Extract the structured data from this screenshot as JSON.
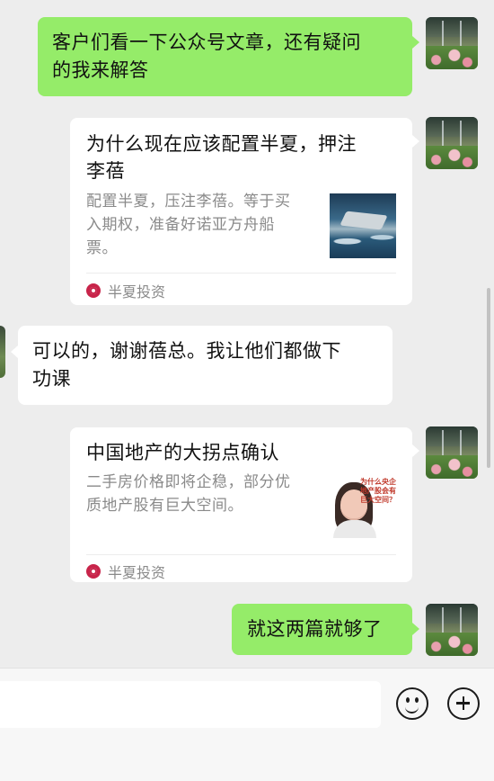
{
  "messages": [
    {
      "side": "right",
      "type": "text",
      "lines": [
        "客户们看一下公众号文章，还有疑问",
        "的我来解答"
      ]
    },
    {
      "side": "right",
      "type": "article",
      "title_lines": [
        "为什么现在应该配置半夏，押注",
        "李蓓"
      ],
      "desc_lines": [
        "配置半夏，压注李蓓。等于买",
        "入期权，准备好诺亚方舟船",
        "票。"
      ],
      "source": "半夏投资",
      "thumb": "ship-in-storm"
    },
    {
      "side": "left",
      "type": "text",
      "lines": [
        "可以的，谢谢蓓总。我让他们都做下",
        "功课"
      ]
    },
    {
      "side": "right",
      "type": "article",
      "title_lines": [
        "中国地产的大拐点确认"
      ],
      "desc_lines": [
        "二手房价格即将企稳，部分优",
        "质地产股有巨大空间。"
      ],
      "source": "半夏投资",
      "thumb": "woman-portrait",
      "thumb_text": "为什么央企地产股会有巨大空间？"
    },
    {
      "side": "right",
      "type": "text",
      "lines": [
        "就这两篇就够了"
      ]
    }
  ],
  "input_bar": {
    "placeholder": "",
    "emoji_icon": "emoji-icon",
    "plus_icon": "plus-icon"
  },
  "colors": {
    "background": "#ededed",
    "my_bubble": "#95ec69",
    "their_bubble": "#ffffff",
    "source_icon": "#c8244a"
  }
}
